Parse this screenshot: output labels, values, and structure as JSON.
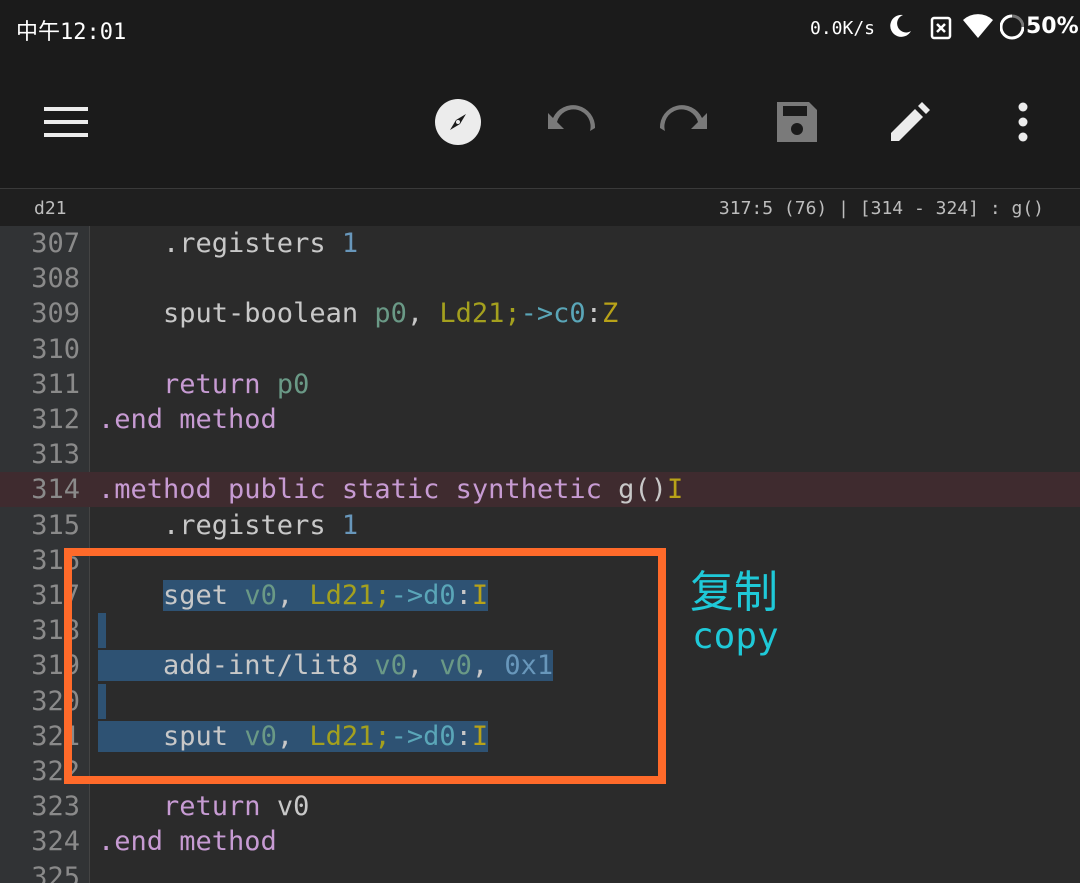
{
  "status_bar": {
    "time": "中午12:01",
    "net_speed": "0.0K/s",
    "battery": "50%"
  },
  "toolbar": {
    "icons": [
      "menu-icon",
      "compass-icon",
      "undo-icon",
      "redo-icon",
      "save-icon",
      "edit-icon",
      "more-vert-icon"
    ]
  },
  "info_bar": {
    "filename": "d21",
    "cursor": "317:5 (76) | [314 - 324] : g()"
  },
  "colors": {
    "background": "#2b2b2b",
    "toolbar": "#1b1b1b",
    "selection": "#2e5273",
    "current_line": "#3f2b2f",
    "annotation_box": "#ff6a2a",
    "annotation_text": "#1fc9d8"
  },
  "editor": {
    "lines": [
      {
        "n": "307",
        "tokens": [
          [
            "plain",
            "    .registers "
          ],
          [
            "num",
            "1"
          ]
        ]
      },
      {
        "n": "308",
        "tokens": []
      },
      {
        "n": "309",
        "tokens": [
          [
            "plain",
            "    sput-boolean "
          ],
          [
            "reg",
            "p0"
          ],
          [
            "plain",
            ", "
          ],
          [
            "cls",
            "Ld21;"
          ],
          [
            "arrow",
            "->"
          ],
          [
            "fld",
            "c0"
          ],
          [
            "plain",
            ":"
          ],
          [
            "typ",
            "Z"
          ]
        ]
      },
      {
        "n": "310",
        "tokens": []
      },
      {
        "n": "311",
        "tokens": [
          [
            "kw",
            "    return "
          ],
          [
            "reg",
            "p0"
          ]
        ]
      },
      {
        "n": "312",
        "tokens": [
          [
            "dir",
            ".end method"
          ]
        ]
      },
      {
        "n": "313",
        "tokens": []
      },
      {
        "n": "314",
        "current": true,
        "tokens": [
          [
            "dir",
            ".method public static synthetic "
          ],
          [
            "plain",
            "g()"
          ],
          [
            "typ",
            "I"
          ]
        ]
      },
      {
        "n": "315",
        "tokens": [
          [
            "plain",
            "    .registers "
          ],
          [
            "num",
            "1"
          ]
        ]
      },
      {
        "n": "316",
        "tokens": []
      },
      {
        "n": "317",
        "sel": "partial",
        "tokens": [
          [
            "plain",
            "    "
          ],
          [
            "plain sel",
            "sget "
          ],
          [
            "reg sel",
            "v0"
          ],
          [
            "plain sel",
            ", "
          ],
          [
            "cls sel",
            "Ld21;"
          ],
          [
            "arrow sel",
            "->"
          ],
          [
            "fld sel",
            "d0"
          ],
          [
            "plain sel",
            ":"
          ],
          [
            "typ sel",
            "I"
          ]
        ]
      },
      {
        "n": "318",
        "sel": "blank",
        "tokens": []
      },
      {
        "n": "319",
        "sel": "full",
        "tokens": [
          [
            "plain sel",
            "    add-int/lit8 "
          ],
          [
            "reg sel",
            "v0"
          ],
          [
            "plain sel",
            ", "
          ],
          [
            "reg sel",
            "v0"
          ],
          [
            "plain sel",
            ", "
          ],
          [
            "num sel",
            "0x1"
          ]
        ]
      },
      {
        "n": "320",
        "sel": "blank",
        "tokens": []
      },
      {
        "n": "321",
        "sel": "full",
        "tokens": [
          [
            "plain sel",
            "    sput "
          ],
          [
            "reg sel",
            "v0"
          ],
          [
            "plain sel",
            ", "
          ],
          [
            "cls sel",
            "Ld21;"
          ],
          [
            "arrow sel",
            "->"
          ],
          [
            "fld sel",
            "d0"
          ],
          [
            "plain sel",
            ":"
          ],
          [
            "typ sel",
            "I"
          ]
        ]
      },
      {
        "n": "322",
        "tokens": []
      },
      {
        "n": "323",
        "tokens": [
          [
            "kw",
            "    return "
          ],
          [
            "plain",
            "v0"
          ]
        ]
      },
      {
        "n": "324",
        "tokens": [
          [
            "dir",
            ".end method"
          ]
        ]
      },
      {
        "n": "325",
        "tokens": []
      }
    ]
  },
  "annotation": {
    "title_cn": "复制",
    "title_en": "copy"
  }
}
